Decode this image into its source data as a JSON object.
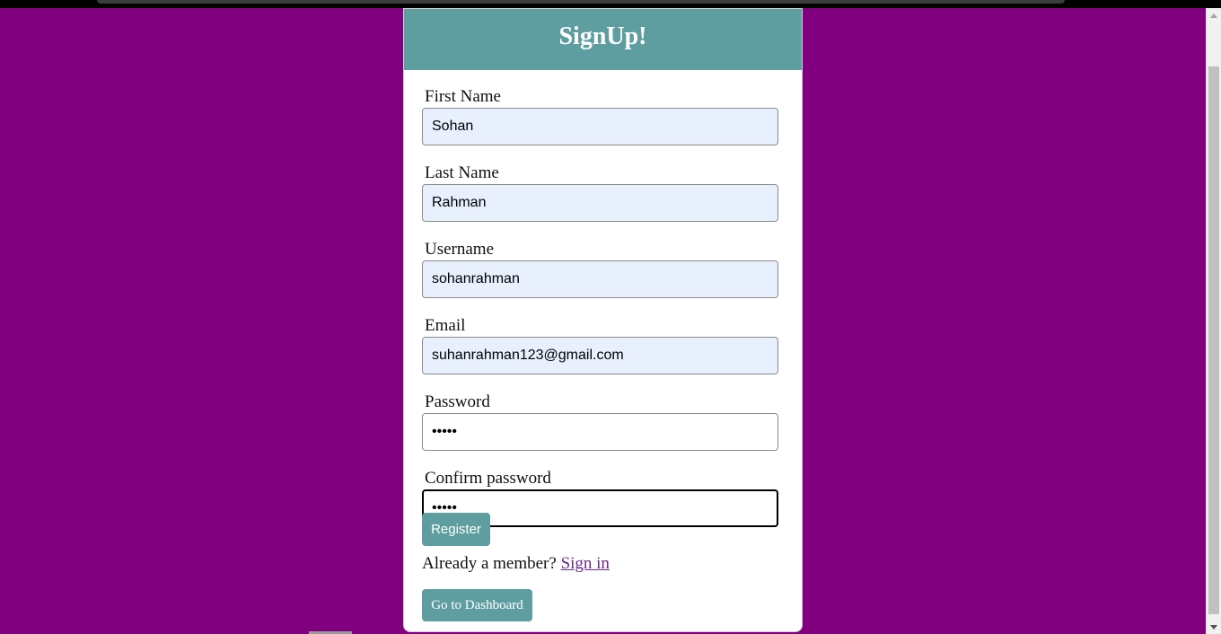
{
  "page": {
    "title": "SignUp!",
    "background_color": "#800080",
    "accent_color": "#5f9ea0"
  },
  "fields": {
    "first_name": {
      "label": "First Name",
      "value": "Sohan"
    },
    "last_name": {
      "label": "Last Name",
      "value": "Rahman"
    },
    "username": {
      "label": "Username",
      "value": "sohanrahman"
    },
    "email": {
      "label": "Email",
      "value": "suhanrahman123@gmail.com"
    },
    "password": {
      "label": "Password",
      "value": "•••••"
    },
    "confirm_password": {
      "label": "Confirm password",
      "value": "•••••"
    }
  },
  "actions": {
    "register_label": "Register",
    "member_prompt": "Already a member?",
    "signin_label": "Sign in",
    "dashboard_label": "Go to Dashboard"
  }
}
